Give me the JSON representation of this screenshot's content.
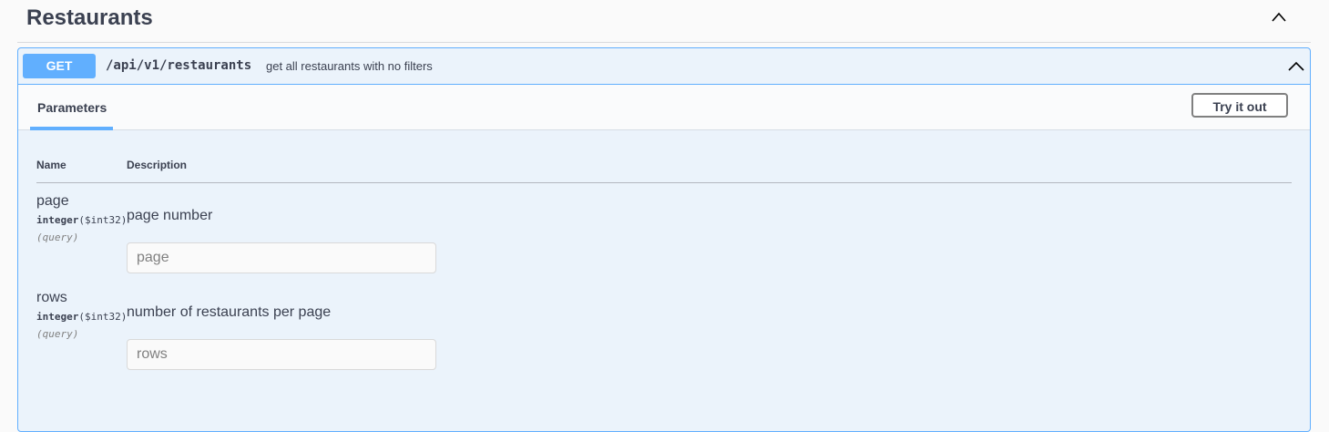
{
  "section": {
    "title": "Restaurants",
    "collapse_icon": "chevron-up-icon"
  },
  "operation": {
    "method": "GET",
    "path": "/api/v1/restaurants",
    "summary": "get all restaurants with no filters",
    "collapse_icon": "chevron-up-icon",
    "accent_color": "#61affe"
  },
  "tabs": {
    "parameters_label": "Parameters",
    "try_button_label": "Try it out"
  },
  "table": {
    "headers": {
      "name": "Name",
      "description": "Description"
    },
    "params": [
      {
        "name": "page",
        "type": "integer",
        "format": "($int32)",
        "in": "(query)",
        "description": "page number",
        "placeholder": "page"
      },
      {
        "name": "rows",
        "type": "integer",
        "format": "($int32)",
        "in": "(query)",
        "description": "number of restaurants per page",
        "placeholder": "rows"
      }
    ]
  }
}
